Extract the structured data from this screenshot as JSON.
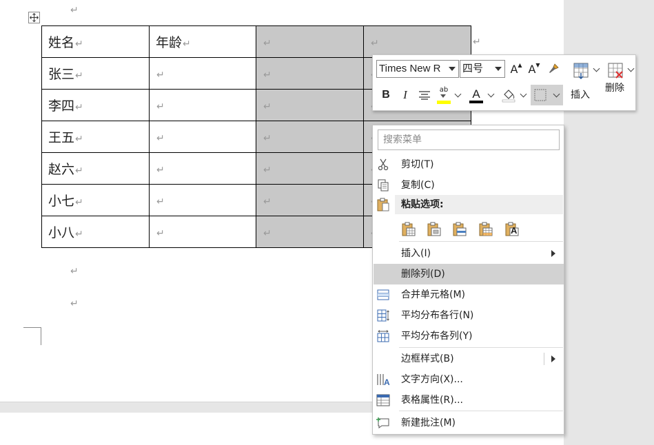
{
  "table": {
    "rows": [
      [
        "姓名",
        "年龄",
        "",
        ""
      ],
      [
        "张三",
        "",
        "",
        ""
      ],
      [
        "李四",
        "",
        "",
        ""
      ],
      [
        "王五",
        "",
        "",
        ""
      ],
      [
        "赵六",
        "",
        "",
        ""
      ],
      [
        "小七",
        "",
        "",
        ""
      ],
      [
        "小八",
        "",
        "",
        ""
      ]
    ],
    "paragraph_mark": "↵"
  },
  "mini_toolbar": {
    "font_name": "Times New R",
    "font_size": "四号",
    "grow_font": "A",
    "shrink_font": "A",
    "bold": "B",
    "italic": "I",
    "font_color": "A",
    "highlight_text": "ab",
    "insert_label": "插入",
    "delete_label": "删除"
  },
  "context_menu": {
    "search_placeholder": "搜索菜单",
    "cut": "剪切(T)",
    "copy": "复制(C)",
    "paste_options": "粘贴选项:",
    "paste_a": "A",
    "insert": "插入(I)",
    "delete_column": "删除列(D)",
    "merge_cells": "合并单元格(M)",
    "distribute_rows": "平均分布各行(N)",
    "distribute_columns": "平均分布各列(Y)",
    "border_styles": "边框样式(B)",
    "text_direction": "文字方向(X)...",
    "table_properties": "表格属性(R)...",
    "new_comment": "新建批注(M)",
    "text_direction_glyph": "A"
  },
  "colors": {
    "selection": "#c8c8c8",
    "highlight_yellow": "#ffff00",
    "font_red": "#000000",
    "menu_hover": "#d2d2d2"
  }
}
